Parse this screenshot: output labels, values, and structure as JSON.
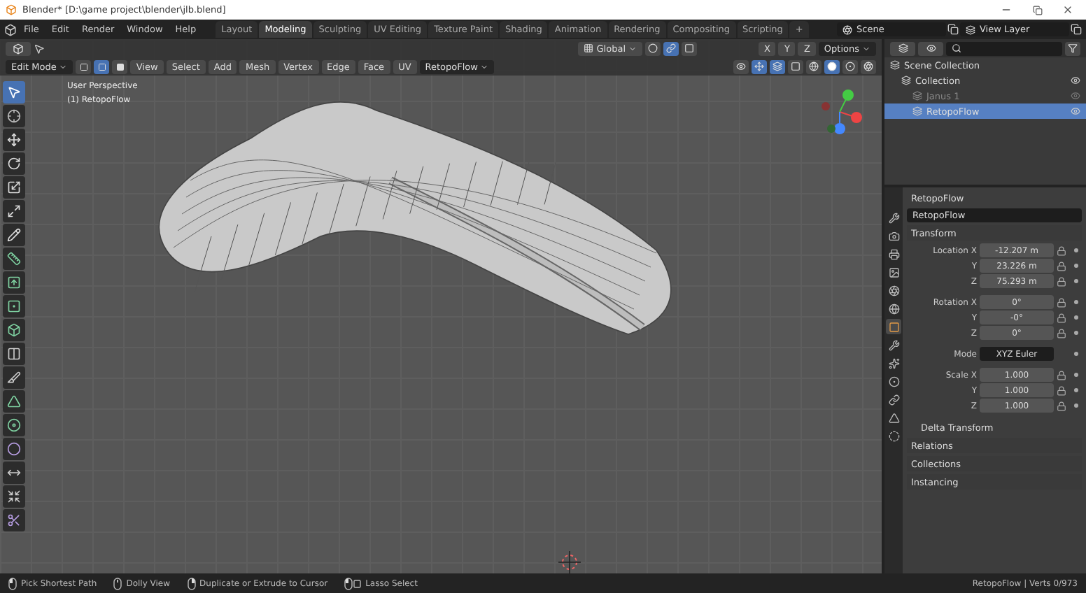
{
  "window": {
    "title": "Blender* [D:\\game project\\blender\\jlb.blend]"
  },
  "menu": [
    "File",
    "Edit",
    "Render",
    "Window",
    "Help"
  ],
  "workspaces": [
    {
      "label": "Layout",
      "selected": false
    },
    {
      "label": "Modeling",
      "selected": true
    },
    {
      "label": "Sculpting",
      "selected": false
    },
    {
      "label": "UV Editing",
      "selected": false
    },
    {
      "label": "Texture Paint",
      "selected": false
    },
    {
      "label": "Shading",
      "selected": false
    },
    {
      "label": "Animation",
      "selected": false
    },
    {
      "label": "Rendering",
      "selected": false
    },
    {
      "label": "Compositing",
      "selected": false
    },
    {
      "label": "Scripting",
      "selected": false
    }
  ],
  "add_workspace": "+",
  "scene": "Scene",
  "view_layer": "View Layer",
  "viewport": {
    "orientation": "Global",
    "axes": [
      "X",
      "Y",
      "Z"
    ],
    "options": "Options",
    "mode": "Edit Mode",
    "menus": [
      "View",
      "Select",
      "Add",
      "Mesh",
      "Vertex",
      "Edge",
      "Face",
      "UV"
    ],
    "addon": "RetopoFlow",
    "overlay": [
      "User Perspective",
      "(1) RetopoFlow"
    ],
    "tools": [
      {
        "kind": "select",
        "selected": true
      },
      {
        "kind": "cursor",
        "selected": false
      },
      {
        "kind": "move",
        "selected": false
      },
      {
        "kind": "rotate",
        "selected": false
      },
      {
        "kind": "scale",
        "selected": false
      },
      {
        "kind": "transform",
        "selected": false
      },
      {
        "kind": "annotate",
        "selected": false
      },
      {
        "kind": "measure",
        "selected": false
      },
      {
        "kind": "extrude",
        "selected": false
      },
      {
        "kind": "inset",
        "selected": false
      },
      {
        "kind": "bevel",
        "selected": false
      },
      {
        "kind": "loopcut",
        "selected": false
      },
      {
        "kind": "knife",
        "selected": false
      },
      {
        "kind": "polybuild",
        "selected": false
      },
      {
        "kind": "spin",
        "selected": false
      },
      {
        "kind": "smooth",
        "selected": false
      },
      {
        "kind": "slide",
        "selected": false
      },
      {
        "kind": "shrink",
        "selected": false
      },
      {
        "kind": "rip",
        "selected": false
      }
    ]
  },
  "outliner": {
    "items": [
      {
        "label": "Scene Collection",
        "selected": false,
        "dimmed": false,
        "children": [
          {
            "label": "Collection",
            "selected": false,
            "dimmed": false,
            "children": [
              {
                "label": "Janus 1",
                "selected": false,
                "dimmed": true
              },
              {
                "label": "RetopoFlow",
                "selected": true,
                "dimmed": false
              }
            ]
          }
        ]
      }
    ]
  },
  "properties": {
    "object": "RetopoFlow",
    "name": "RetopoFlow",
    "tabs": [
      {
        "kind": "tool",
        "selected": false
      },
      {
        "kind": "render",
        "selected": false
      },
      {
        "kind": "output",
        "selected": false
      },
      {
        "kind": "view",
        "selected": false
      },
      {
        "kind": "scene",
        "selected": false
      },
      {
        "kind": "world",
        "selected": false
      },
      {
        "kind": "object",
        "selected": true
      },
      {
        "kind": "modifiers",
        "selected": false
      },
      {
        "kind": "particles",
        "selected": false
      },
      {
        "kind": "physics",
        "selected": false
      },
      {
        "kind": "constraints",
        "selected": false
      },
      {
        "kind": "data",
        "selected": false
      },
      {
        "kind": "material",
        "selected": false
      }
    ],
    "transform": {
      "title": "Transform",
      "groups": [
        {
          "kind": "fields",
          "rows": [
            {
              "label": "Location X",
              "value": "-12.207 m"
            },
            {
              "label": "Y",
              "value": "23.226 m"
            },
            {
              "label": "Z",
              "value": "75.293 m"
            }
          ]
        },
        {
          "kind": "fields",
          "rows": [
            {
              "label": "Rotation X",
              "value": "0°"
            },
            {
              "label": "Y",
              "value": "-0°"
            },
            {
              "label": "Z",
              "value": "0°"
            }
          ]
        },
        {
          "kind": "dropdown",
          "rows": [
            {
              "label": "Mode",
              "value": "XYZ Euler"
            }
          ]
        },
        {
          "kind": "fields",
          "rows": [
            {
              "label": "Scale X",
              "value": "1.000"
            },
            {
              "label": "Y",
              "value": "1.000"
            },
            {
              "label": "Z",
              "value": "1.000"
            }
          ]
        }
      ],
      "subpanel": "Delta Transform"
    },
    "panels": [
      "Relations",
      "Collections",
      "Instancing"
    ]
  },
  "status_bar": {
    "items": [
      {
        "kind": "left",
        "label": "Pick Shortest Path"
      },
      {
        "kind": "middle",
        "label": "Dolly View"
      },
      {
        "kind": "right",
        "label": "Duplicate or Extrude to Cursor"
      },
      {
        "kind": "ctrl",
        "label": "Lasso Select"
      }
    ],
    "stats": "RetopoFlow | Verts 0/973"
  }
}
